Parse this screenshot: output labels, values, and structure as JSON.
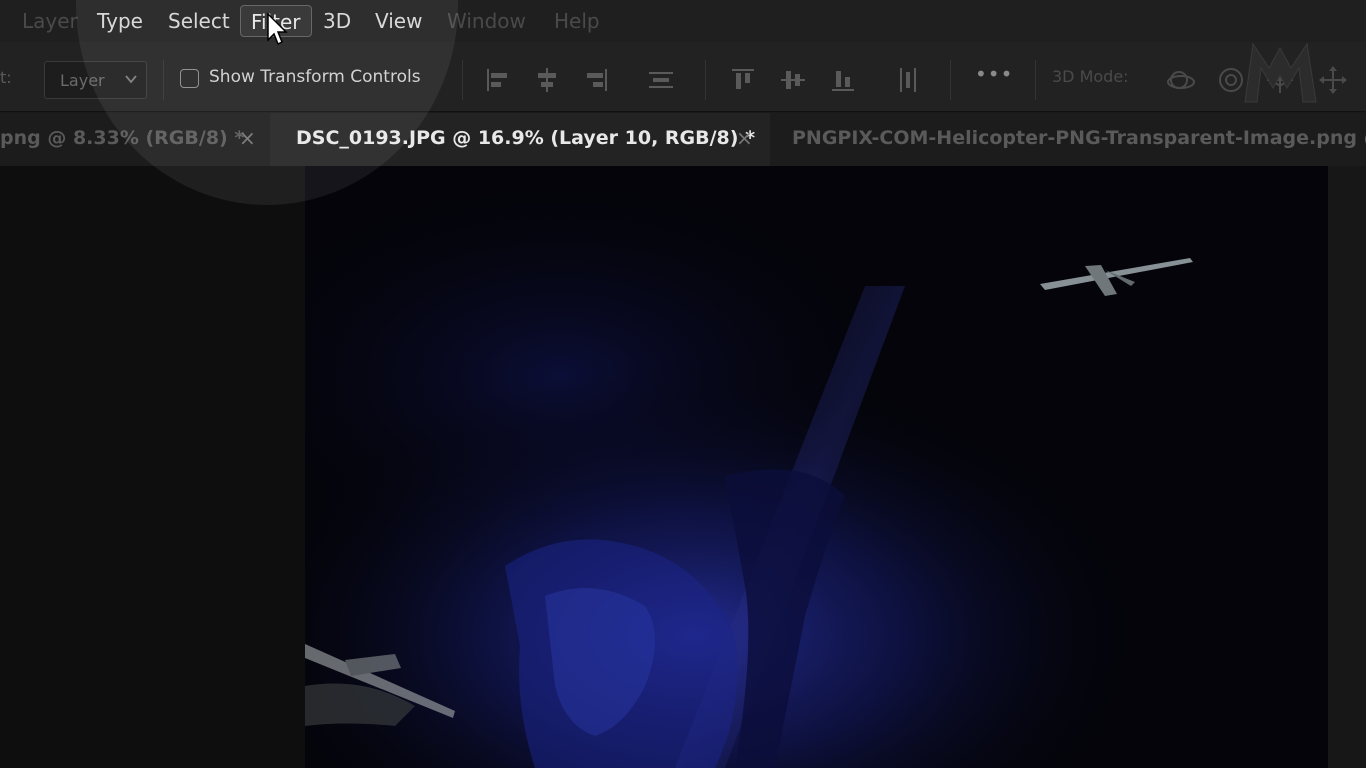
{
  "menubar": {
    "items": [
      {
        "label": "Layer"
      },
      {
        "label": "Type"
      },
      {
        "label": "Select"
      },
      {
        "label": "Filter"
      },
      {
        "label": "3D"
      },
      {
        "label": "View"
      },
      {
        "label": "Window"
      },
      {
        "label": "Help"
      }
    ],
    "active_item": "Filter"
  },
  "options": {
    "target_label": "t:",
    "auto_select_value": "Layer",
    "show_transform_label": "Show Transform Controls",
    "show_transform_checked": false,
    "mode_3d_label": "3D Mode:",
    "more_label": "•••"
  },
  "tabs": [
    {
      "label": "png @ 8.33% (RGB/8) *",
      "close": "×",
      "active": false
    },
    {
      "label": "DSC_0193.JPG @ 16.9% (Layer 10, RGB/8) *",
      "close": "×",
      "active": true
    },
    {
      "label": "PNGPIX-COM-Helicopter-PNG-Transparent-Image.png @",
      "close": "",
      "active": false
    }
  ],
  "colors": {
    "accent_canvas": "#1b1f7a",
    "menubar_bg": "#1f1f1f"
  }
}
